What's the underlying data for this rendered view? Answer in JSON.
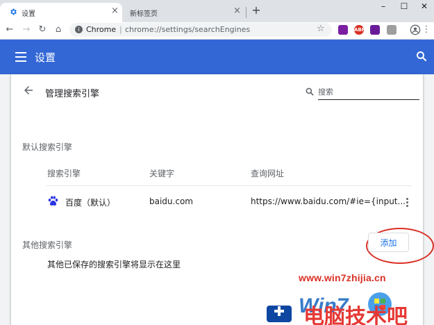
{
  "tabs": [
    {
      "label": "设置",
      "active": true
    },
    {
      "label": "新标签页",
      "active": false
    }
  ],
  "window_controls": {
    "minimize": "–",
    "maximize": "☐",
    "close": "✕"
  },
  "toolbar": {
    "site_label": "Chrome",
    "url_path": "chrome://settings/searchEngines",
    "extensions": [
      {
        "name": "extension-1",
        "text": "",
        "color": "#7b1fa2"
      },
      {
        "name": "adblock-plus",
        "text": "ABP",
        "color": "#d93025"
      },
      {
        "name": "extension-3",
        "text": "",
        "color": "#6a1b9a"
      },
      {
        "name": "extension-4",
        "text": "",
        "color": "#9e9e9e"
      }
    ]
  },
  "header": {
    "title": "设置",
    "accent": "#3367d6"
  },
  "page": {
    "title": "管理搜索引擎",
    "search_placeholder": "搜索",
    "default_section": "默认搜索引擎",
    "columns": [
      "搜索引擎",
      "关键字",
      "查询网址"
    ],
    "engines": [
      {
        "name": "百度（默认）",
        "keyword": "baidu.com",
        "url": "https://www.baidu.com/#ie={input..."
      }
    ],
    "other_section": "其他搜索引擎",
    "add_label": "添加",
    "other_empty": "其他已保存的搜索引擎将显示在这里"
  },
  "watermark": {
    "url": "www.win7zhijia.cn",
    "logo_text": "Win7",
    "brand": "电脑技术吧"
  }
}
